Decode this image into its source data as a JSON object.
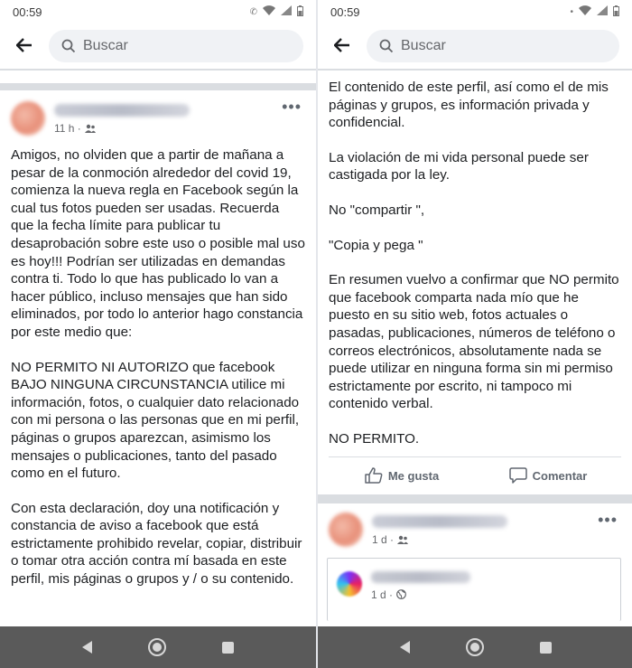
{
  "status_bar": {
    "time_left": "00:59",
    "time_right": "00:59"
  },
  "search": {
    "placeholder": "Buscar"
  },
  "post_main": {
    "meta_time": "11 h ·",
    "paragraph_1": "Amigos, no olviden que a partir de mañana a pesar de la conmoción alrededor del covid 19, comienza la nueva regla en Facebook según la cual tus fotos pueden ser usadas. Recuerda que la fecha límite para publicar tu desaprobación sobre este uso o posible mal uso es hoy!!! Podrían ser utilizadas en demandas contra ti. Todo lo que has publicado lo van a hacer público, incluso mensajes que han sido eliminados, por todo lo anterior hago constancia por este medio que:",
    "paragraph_2": "NO PERMITO NI AUTORIZO que facebook BAJO NINGUNA CIRCUNSTANCIA utilice mi información, fotos, o cualquier dato relacionado con mi persona o las personas que en mi perfil, páginas o grupos aparezcan, asimismo los mensajes o publicaciones, tanto del pasado como en el futuro.",
    "paragraph_3": "Con esta declaración, doy una notificación y constancia de aviso a facebook que está estrictamente prohibido revelar, copiar, distribuir o tomar otra acción contra mí basada en este perfil, mis páginas o grupos y / o su contenido."
  },
  "post_continued": {
    "paragraph_1": "El contenido de este perfil, así como el de mis páginas y grupos, es información privada y confidencial.",
    "paragraph_2": "La violación de mi vida personal puede ser castigada por la ley.",
    "paragraph_3": "No \"compartir \",",
    "paragraph_4": "\"Copia y pega \"",
    "paragraph_5": "En resumen vuelvo a confirmar que NO permito que facebook comparta nada mío que he puesto en su sitio web, fotos actuales o pasadas, publicaciones, números de teléfono o correos electrónicos, absolutamente nada se puede utilizar en ninguna forma sin mi permiso estrictamente por escrito, ni tampoco mi contenido verbal.",
    "paragraph_6": "NO PERMITO."
  },
  "actions": {
    "like_label": "Me gusta",
    "comment_label": "Comentar"
  },
  "post_next": {
    "meta_time": "1 d ·",
    "shared_meta_time": "1 d ·"
  },
  "icons": {
    "back": "back-arrow-icon",
    "search": "search-icon",
    "friends": "friends-audience-icon",
    "globe": "globe-icon",
    "more": "more-options-icon",
    "like": "thumbs-up-icon",
    "comment": "comment-bubble-icon"
  },
  "colors": {
    "text": "#1c1e21",
    "secondary_text": "#65676b",
    "search_bg": "#f0f2f5",
    "separator": "#dadde1",
    "nav_bar": "#5a5a5a"
  }
}
